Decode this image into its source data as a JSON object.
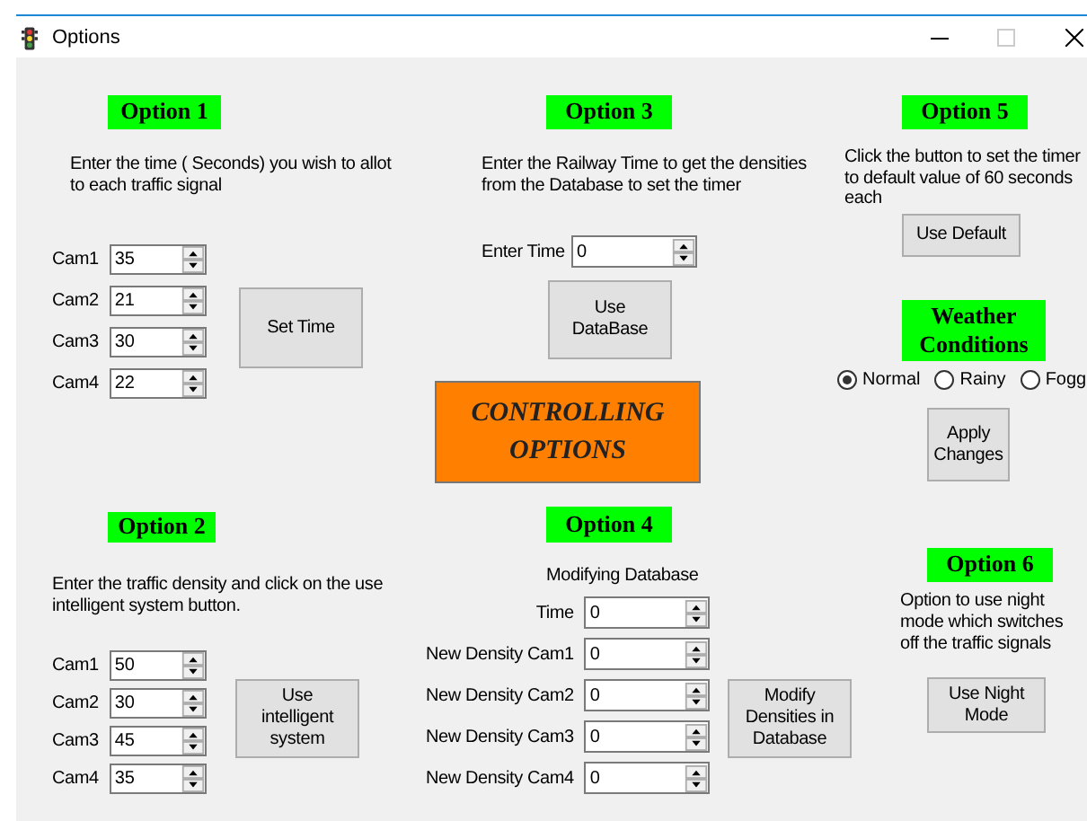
{
  "window": {
    "title": "Options"
  },
  "option1": {
    "heading": "Option 1",
    "description": "Enter the time ( Seconds) you wish to allot to each traffic signal",
    "cams": [
      {
        "label": "Cam1",
        "value": "35"
      },
      {
        "label": "Cam2",
        "value": "21"
      },
      {
        "label": "Cam3",
        "value": "30"
      },
      {
        "label": "Cam4",
        "value": "22"
      }
    ],
    "button": "Set Time"
  },
  "option3": {
    "heading": "Option 3",
    "description": "Enter the Railway Time to get the densities from the Database to set the timer",
    "time_label": "Enter Time",
    "time_value": "0",
    "button": "Use DataBase"
  },
  "option5": {
    "heading": "Option 5",
    "description": "Click the button to set the timer to default value of 60 seconds each",
    "button": "Use Default"
  },
  "weather": {
    "heading": "Weather Conditions",
    "options": [
      {
        "label": "Normal",
        "selected": true
      },
      {
        "label": "Rainy",
        "selected": false
      },
      {
        "label": "Fogg",
        "selected": false
      }
    ],
    "button": "Apply Changes"
  },
  "banner": {
    "text": "CONTROLLING OPTIONS"
  },
  "option2": {
    "heading": "Option 2",
    "description": "Enter the traffic density and click on the use intelligent system button.",
    "cams": [
      {
        "label": "Cam1",
        "value": "50"
      },
      {
        "label": "Cam2",
        "value": "30"
      },
      {
        "label": "Cam3",
        "value": "45"
      },
      {
        "label": "Cam4",
        "value": "35"
      }
    ],
    "button": "Use intelligent system"
  },
  "option4": {
    "heading": "Option 4",
    "subtitle": "Modifying Database",
    "fields": [
      {
        "label": "Time",
        "value": "0"
      },
      {
        "label": "New Density Cam1",
        "value": "0"
      },
      {
        "label": "New Density Cam2",
        "value": "0"
      },
      {
        "label": "New Density Cam3",
        "value": "0"
      },
      {
        "label": "New Density Cam4",
        "value": "0"
      }
    ],
    "button": "Modify Densities in Database"
  },
  "option6": {
    "heading": "Option 6",
    "description": "Option to use night mode which switches off the traffic signals",
    "button": "Use Night Mode"
  }
}
